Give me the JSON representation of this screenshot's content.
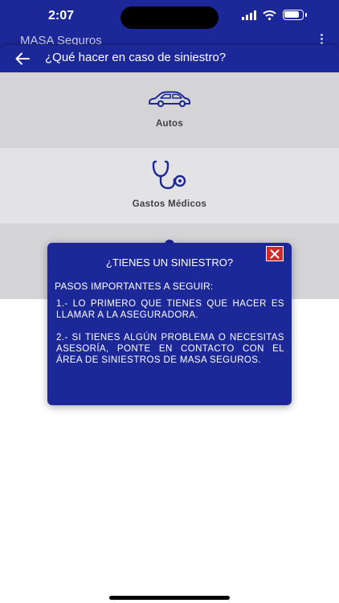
{
  "status_bar": {
    "time": "2:07"
  },
  "behind_app": {
    "title": "MASA Seguros"
  },
  "header": {
    "title": "¿Qué hacer en caso de siniestro?"
  },
  "categories": [
    {
      "label": "Autos",
      "icon": "car-icon"
    },
    {
      "label": "Gastos Médicos",
      "icon": "stethoscope-icon"
    }
  ],
  "dialog": {
    "title": "¿TIENES UN SINIESTRO?",
    "subtitle": "PASOS IMPORTANTES A SEGUIR:",
    "step1": "1.- LO PRIMERO QUE TIENES QUE HACER ES LLAMAR A LA ASEGURADORA.",
    "step2": "2.- SI TIENES ALGÚN PROBLEMA O NECESITAS ASESORÍA, PONTE EN CONTACTO CON EL ÁREA DE SINIESTROS DE MASA SEGUROS."
  },
  "colors": {
    "primary": "#1c2898",
    "close": "#d02a2a",
    "tile_dark": "#d4d4d6",
    "tile_light": "#e3e3e5"
  }
}
